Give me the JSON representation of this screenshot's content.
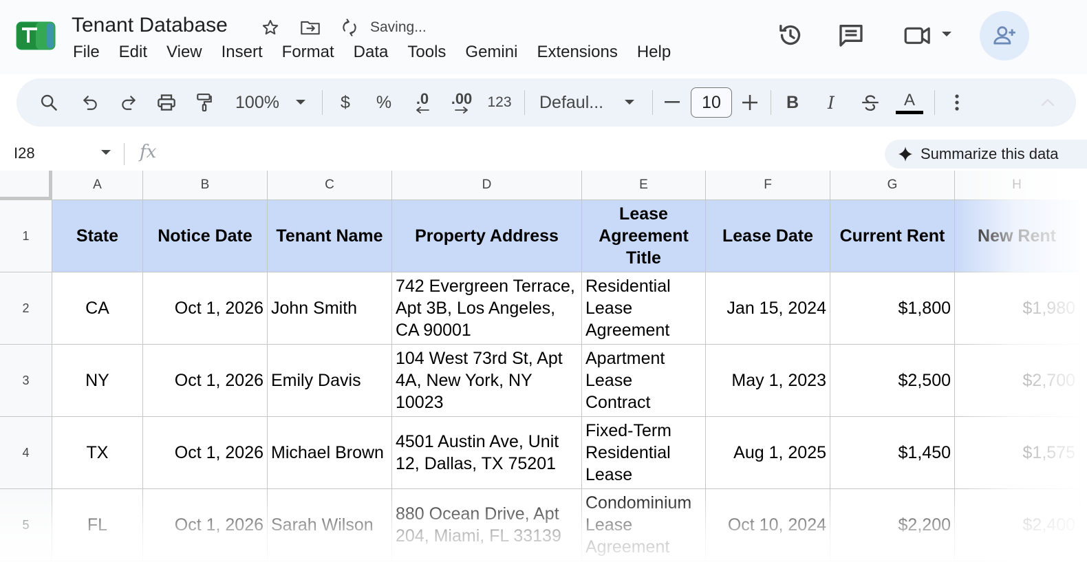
{
  "document": {
    "title": "Tenant Database",
    "status": "Saving..."
  },
  "menu": [
    "File",
    "Edit",
    "View",
    "Insert",
    "Format",
    "Data",
    "Tools",
    "Gemini",
    "Extensions",
    "Help"
  ],
  "toolbar": {
    "zoom": "100%",
    "currency": "$",
    "percent": "%",
    "decrease_decimal": ".0",
    "increase_decimal": ".00",
    "number_format": "123",
    "font": "Defaul...",
    "font_size": "10",
    "bold": "B",
    "italic": "I",
    "text_color_letter": "A"
  },
  "formula_bar": {
    "cell_ref": "I28",
    "fx": "fx",
    "summarize": "Summarize this data"
  },
  "colors": {
    "header_fill": "#c9daf8",
    "text_underline": "#000000",
    "accent_blue": "#0b57d0"
  },
  "sheet": {
    "columns": [
      "A",
      "B",
      "C",
      "D",
      "E",
      "F",
      "G",
      "H"
    ],
    "headers": [
      "State",
      "Notice Date",
      "Tenant Name",
      "Property Address",
      "Lease Agreement Title",
      "Lease Date",
      "Current Rent",
      "New Rent"
    ],
    "rows": [
      {
        "num": "2",
        "cells": [
          "CA",
          "Oct 1, 2026",
          "John Smith",
          "742 Evergreen Terrace, Apt 3B, Los Angeles, CA 90001",
          "Residential Lease Agreement",
          "Jan 15, 2024",
          "$1,800",
          "$1,980"
        ]
      },
      {
        "num": "3",
        "cells": [
          "NY",
          "Oct 1, 2026",
          "Emily Davis",
          "104 West 73rd St, Apt 4A, New York, NY 10023",
          "Apartment Lease Contract",
          "May 1, 2023",
          "$2,500",
          "$2,700"
        ]
      },
      {
        "num": "4",
        "cells": [
          "TX",
          "Oct 1, 2026",
          "Michael Brown",
          "4501 Austin Ave, Unit 12, Dallas, TX 75201",
          "Fixed-Term Residential Lease",
          "Aug 1, 2025",
          "$1,450",
          "$1,575"
        ]
      },
      {
        "num": "5",
        "cells": [
          "FL",
          "Oct 1, 2026",
          "Sarah Wilson",
          "880 Ocean Drive, Apt 204, Miami, FL 33139",
          "Condominium Lease Agreement",
          "Oct 10, 2024",
          "$2,200",
          "$2,400"
        ]
      }
    ],
    "header_row_num": "1"
  }
}
